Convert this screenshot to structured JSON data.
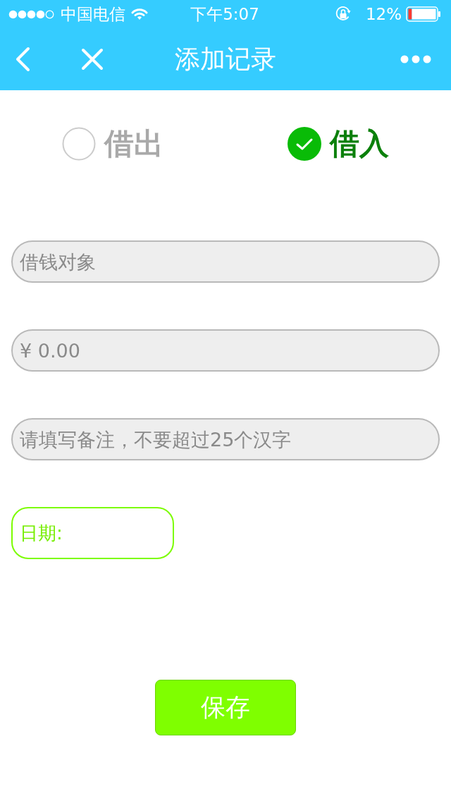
{
  "status_bar": {
    "carrier": "中国电信",
    "time": "下午5:07",
    "battery": "12%"
  },
  "nav_bar": {
    "title": "添加记录"
  },
  "loan_types": [
    {
      "label": "借出",
      "selected": false
    },
    {
      "label": "借入",
      "selected": true
    }
  ],
  "fields": [
    {
      "placeholder": "借钱对象"
    },
    {
      "placeholder": "¥ 0.00"
    },
    {
      "placeholder": "请填写备注，不要超过25个汉字"
    }
  ],
  "date_field": {
    "placeholder": "日期:"
  },
  "save_button": {
    "label": "保存"
  }
}
